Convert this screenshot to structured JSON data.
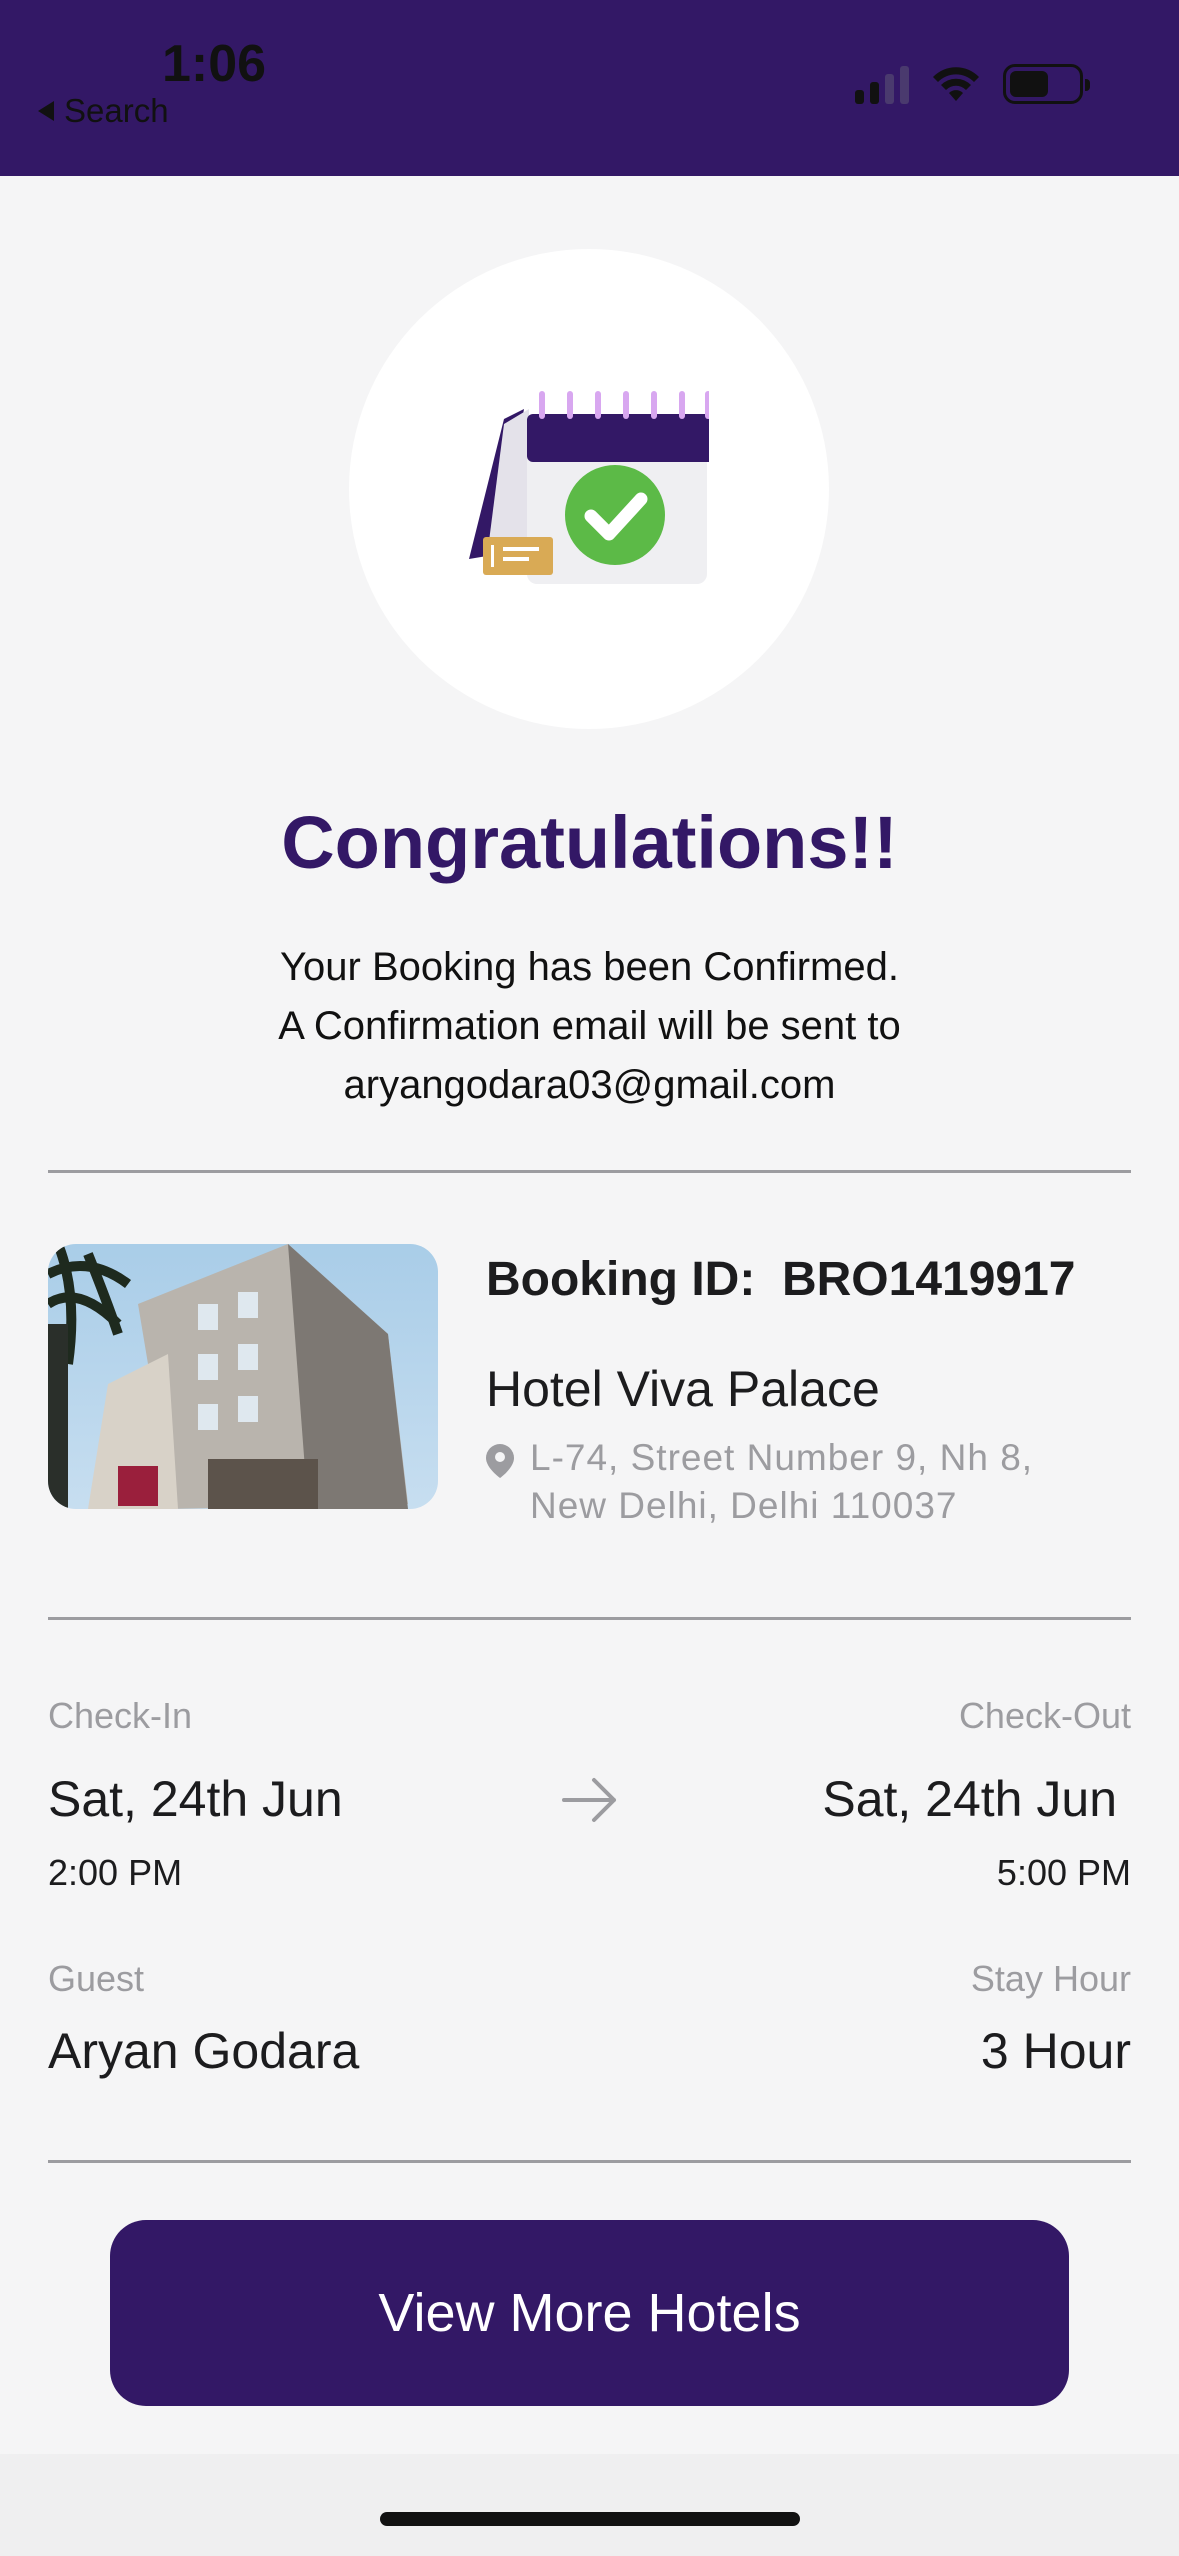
{
  "status_bar": {
    "time": "1:06",
    "back_label": "Search",
    "icons": [
      "cellular-signal-icon",
      "wifi-icon",
      "battery-icon"
    ]
  },
  "hero": {
    "icon": "calendar-confirmed-icon",
    "title": "Congratulations!!",
    "message_line1": "Your Booking has been Confirmed.",
    "message_line2": "A Confirmation email will be sent to",
    "email": "aryangodara03@gmail.com"
  },
  "booking": {
    "id_label": "Booking ID:",
    "id_value": "BRO1419917",
    "hotel_name": "Hotel Viva Palace",
    "address_line1": "L-74, Street Number 9, Nh 8,",
    "address_line2": "New Delhi, Delhi 110037"
  },
  "stay": {
    "checkin_label": "Check-In",
    "checkin_date": "Sat, 24th Jun",
    "checkin_time": "2:00 PM",
    "checkout_label": "Check-Out",
    "checkout_date": "Sat, 24th Jun",
    "checkout_time": "5:00 PM",
    "guest_label": "Guest",
    "guest_name": "Aryan Godara",
    "stay_hour_label": "Stay Hour",
    "stay_hour_value": "3 Hour"
  },
  "cta": {
    "label": "View More Hotels"
  },
  "colors": {
    "brand": "#331866",
    "success": "#5cba47",
    "muted": "#9c9ca0",
    "ticket": "#d9aa55",
    "calendar_pins": "#d8a7f0"
  }
}
